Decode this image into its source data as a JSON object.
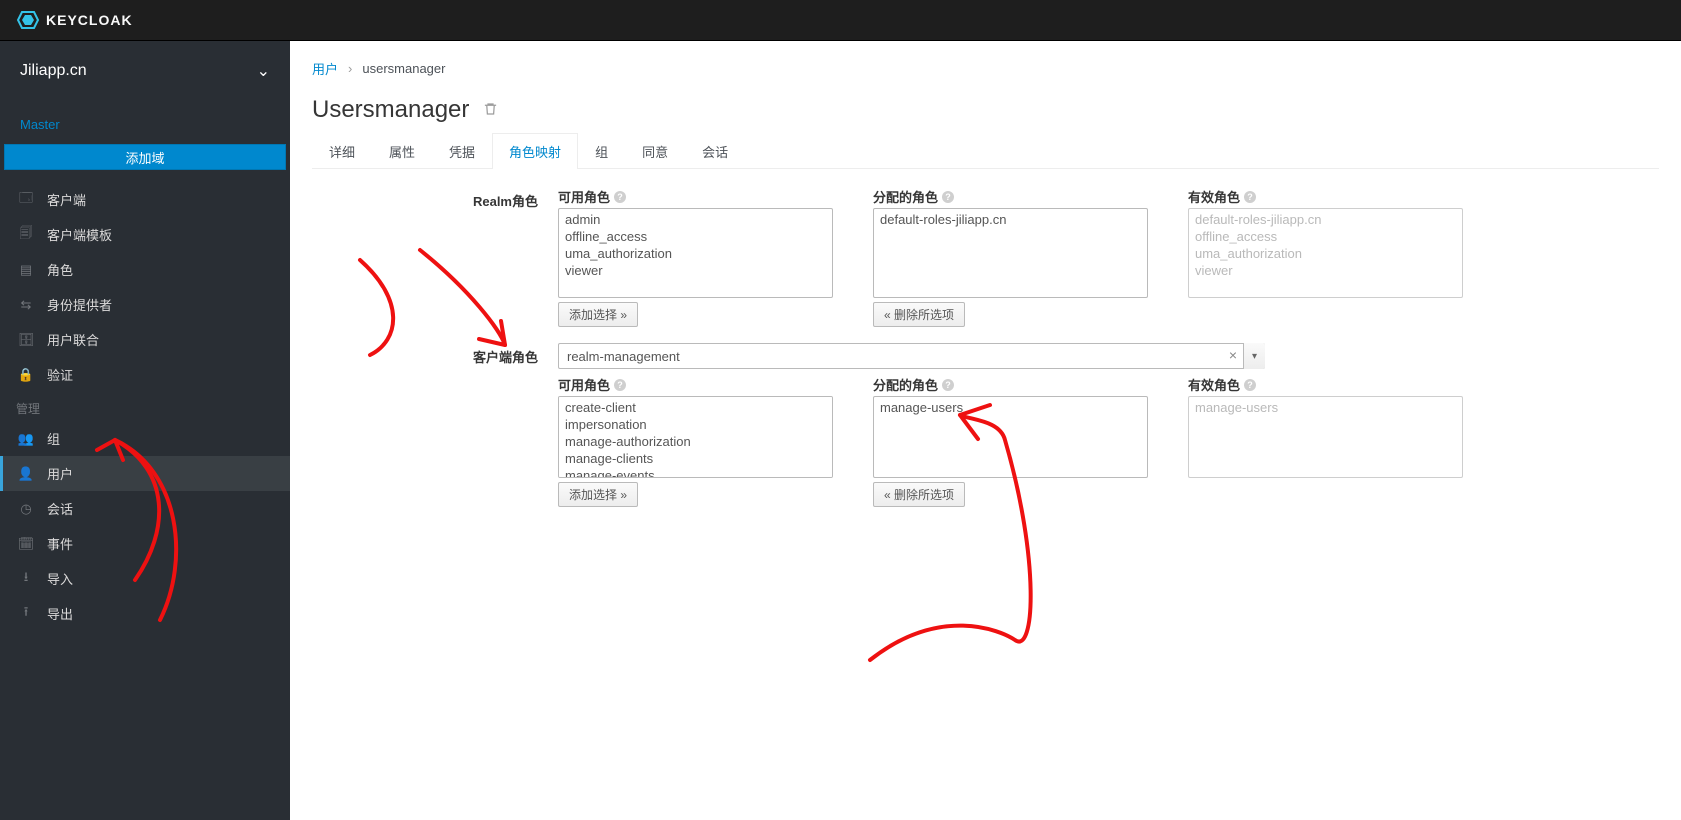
{
  "brand": "KEYCLOAK",
  "realm": {
    "current": "Jiliapp.cn",
    "master": "Master",
    "add_realm_label": "添加域"
  },
  "nav": {
    "section_manage": "管理",
    "items_configure": [
      {
        "label": "客户端"
      },
      {
        "label": "客户端模板"
      },
      {
        "label": "角色"
      },
      {
        "label": "身份提供者"
      },
      {
        "label": "用户联合"
      },
      {
        "label": "验证"
      }
    ],
    "items_manage": [
      {
        "label": "组"
      },
      {
        "label": "用户"
      },
      {
        "label": "会话"
      },
      {
        "label": "事件"
      },
      {
        "label": "导入"
      },
      {
        "label": "导出"
      }
    ]
  },
  "breadcrumb": {
    "users": "用户",
    "current": "usersmanager"
  },
  "page_title": "Usersmanager",
  "tabs": [
    {
      "label": "详细",
      "id": "details"
    },
    {
      "label": "属性",
      "id": "attrs"
    },
    {
      "label": "凭据",
      "id": "creds"
    },
    {
      "label": "角色映射",
      "id": "rolemap"
    },
    {
      "label": "组",
      "id": "groups"
    },
    {
      "label": "同意",
      "id": "consents"
    },
    {
      "label": "会话",
      "id": "sessions"
    }
  ],
  "active_tab": "rolemap",
  "labels": {
    "realm_roles": "Realm角色",
    "available_roles": "可用角色",
    "assigned_roles": "分配的角色",
    "effective_roles": "有效角色",
    "client_roles": "客户端角色",
    "add_selected": "添加选择 »",
    "remove_selected": "« 删除所选项"
  },
  "realm_roles": {
    "available": [
      "admin",
      "offline_access",
      "uma_authorization",
      "viewer"
    ],
    "assigned": [
      "default-roles-jiliapp.cn"
    ],
    "effective": [
      "default-roles-jiliapp.cn",
      "offline_access",
      "uma_authorization",
      "viewer"
    ]
  },
  "client_select": {
    "value": "realm-management"
  },
  "client_roles": {
    "available": [
      "create-client",
      "impersonation",
      "manage-authorization",
      "manage-clients",
      "manage-events"
    ],
    "assigned": [
      "manage-users"
    ],
    "effective": [
      "manage-users"
    ]
  }
}
